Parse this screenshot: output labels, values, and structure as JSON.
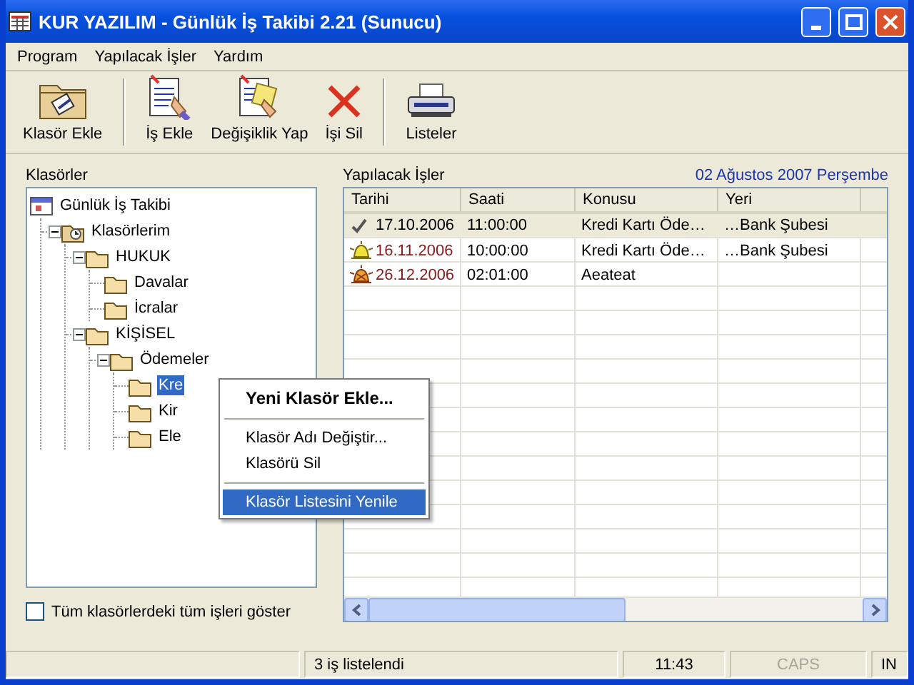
{
  "window": {
    "title": "KUR YAZILIM - Günlük İş Takibi 2.21 (Sunucu)"
  },
  "menu": [
    "Program",
    "Yapılacak İşler",
    "Yardım"
  ],
  "toolbar": [
    {
      "label": "Klasör Ekle",
      "kind": "folder"
    },
    {
      "label": "İş Ekle",
      "kind": "add"
    },
    {
      "label": "Değişiklik Yap",
      "kind": "edit"
    },
    {
      "label": "İşi Sil",
      "kind": "delete"
    },
    {
      "label": "Listeler",
      "kind": "print"
    }
  ],
  "folders": {
    "label": "Klasörler",
    "tree": [
      {
        "label": "Günlük İş Takibi",
        "kind": "app",
        "children": [
          {
            "label": "Klasörlerim",
            "kind": "home",
            "expanded": true,
            "children": [
              {
                "label": "HUKUK",
                "kind": "folder",
                "expanded": true,
                "children": [
                  {
                    "label": "Davalar",
                    "kind": "folder",
                    "selected": false
                  },
                  {
                    "label": "İcralar",
                    "kind": "folder",
                    "selected": false
                  }
                ]
              },
              {
                "label": "KİŞİSEL",
                "kind": "folder",
                "expanded": true,
                "children": [
                  {
                    "label": "Ödemeler",
                    "kind": "folder",
                    "expanded": true,
                    "children": [
                      {
                        "label": "Kre",
                        "kind": "folder",
                        "selected": true
                      },
                      {
                        "label": "Kir",
                        "kind": "folder",
                        "selected": false
                      },
                      {
                        "label": "Ele",
                        "kind": "folder",
                        "selected": false
                      }
                    ]
                  }
                ]
              }
            ]
          }
        ]
      }
    ]
  },
  "show_all": {
    "label": "Tüm klasörlerdeki tüm işleri göster",
    "checked": false
  },
  "tasks": {
    "label": "Yapılacak İşler",
    "date": "02 Ağustos 2007 Perşembe",
    "columns": [
      "Tarihi",
      "Saati",
      "Konusu",
      "Yeri"
    ],
    "rows": [
      {
        "kind": "done",
        "selected": true,
        "cells": [
          "17.10.2006",
          "11:00:00",
          "Kredi Kartı Öde…",
          "…Bank Şubesi"
        ]
      },
      {
        "kind": "reminder",
        "selected": false,
        "cells": [
          "16.11.2006",
          "10:00:00",
          "Kredi Kartı Öde…",
          "…Bank Şubesi"
        ]
      },
      {
        "kind": "alarm",
        "selected": false,
        "cells": [
          "26.12.2006",
          "02:01:00",
          "Aeateat"
        ]
      }
    ]
  },
  "context_menu": [
    {
      "label": "Yeni Klasör Ekle...",
      "kind": "default",
      "selected": false
    },
    {
      "kind": "separator"
    },
    {
      "label": "Klasör Adı Değiştir...",
      "kind": "item",
      "selected": false
    },
    {
      "label": "Klasörü Sil",
      "kind": "item",
      "selected": false
    },
    {
      "kind": "separator"
    },
    {
      "label": "Klasör Listesini Yenile",
      "kind": "item",
      "selected": true
    }
  ],
  "status_bar": [
    {
      "text": "3 iş listelendi"
    },
    {
      "text": "11:43"
    },
    {
      "text": "CAPS",
      "disabled": true
    },
    {
      "text": "IN"
    }
  ]
}
